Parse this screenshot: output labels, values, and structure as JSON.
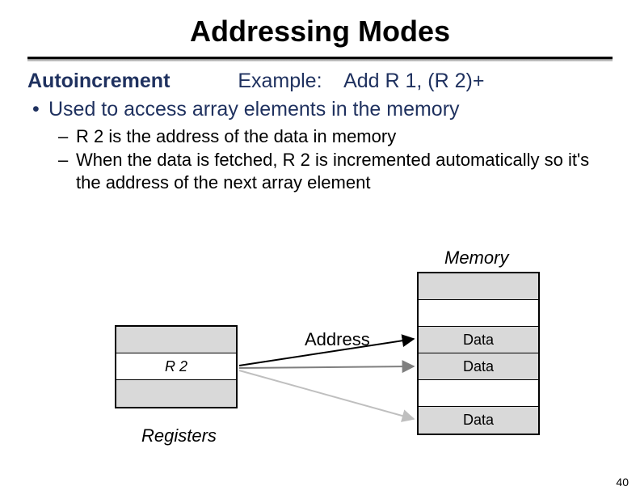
{
  "title": "Addressing Modes",
  "line1": {
    "mode": "Autoincrement",
    "example_label": "Example:",
    "example_code": "Add   R 1, (R 2)+"
  },
  "bullet1": "Used to access array elements in the memory",
  "sub1": "R 2 is the address of the data in memory",
  "sub2": "When the data is fetched, R 2 is incremented automatically so it's the address of the next array element",
  "diagram": {
    "memory_label": "Memory",
    "address_label": "Address",
    "registers_label": "Registers",
    "register_name": "R 2",
    "mem_cells": [
      "",
      "",
      "Data",
      "Data",
      "",
      "Data"
    ]
  },
  "page_number": "40"
}
